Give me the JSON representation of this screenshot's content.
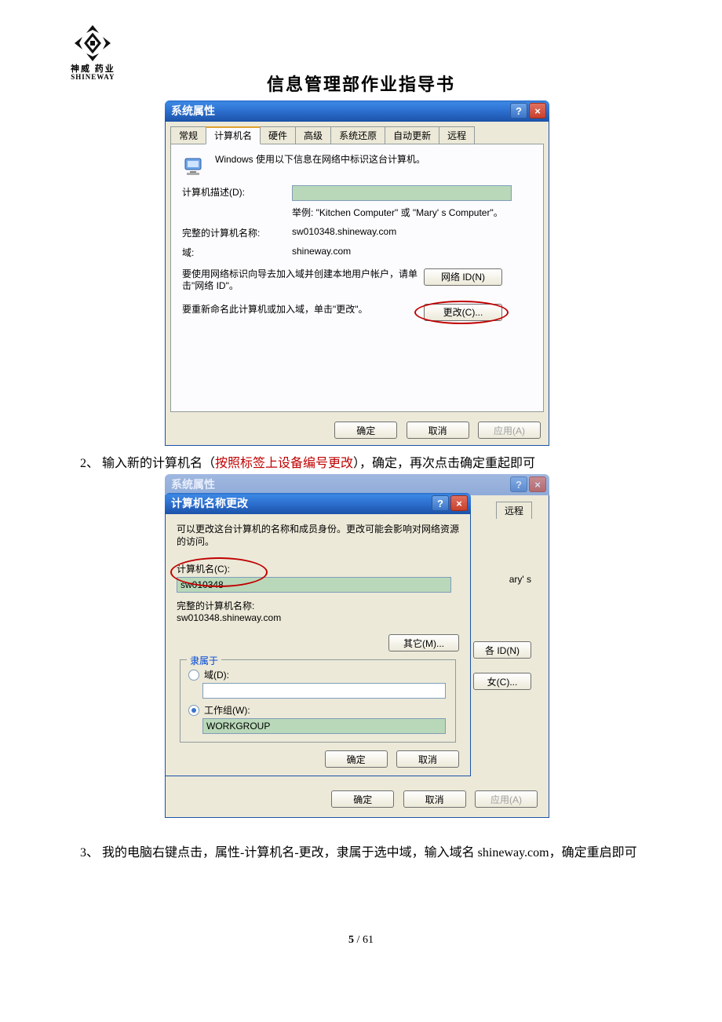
{
  "logo": {
    "line1": "神威 药业",
    "line2": "SHINEWAY"
  },
  "doc_title": "信息管理部作业指导书",
  "dlg1": {
    "title": "系统属性",
    "tabs": [
      "常规",
      "计算机名",
      "硬件",
      "高级",
      "系统还原",
      "自动更新",
      "远程"
    ],
    "banner": "Windows 使用以下信息在网络中标识这台计算机。",
    "desc_label": "计算机描述(D):",
    "example": "举例: \"Kitchen Computer\" 或 \"Mary' s Computer\"。",
    "fullname_label": "完整的计算机名称:",
    "fullname_value": "sw010348.shineway.com",
    "domain_label": "域:",
    "domain_value": "shineway.com",
    "netid_text": "要使用网络标识向导去加入域并创建本地用户帐户，请单击\"网络 ID\"。",
    "netid_btn": "网络 ID(N)",
    "change_text": "要重新命名此计算机或加入域，单击\"更改\"。",
    "change_btn": "更改(C)...",
    "ok": "确定",
    "cancel": "取消",
    "apply": "应用(A)"
  },
  "step2": {
    "prefix": "2、 输入新的计算机名（",
    "red": "按照标签上设备编号更改",
    "suffix": "），确定，再次点击确定重起即可"
  },
  "dlg2_under": {
    "title": "系统属性",
    "visible_tab": "远程",
    "peek1": "ary' s",
    "peek2": "各 ID(N)",
    "peek3": "女(C)...",
    "ok": "确定",
    "cancel": "取消",
    "apply": "应用(A)"
  },
  "dlg2": {
    "title": "计算机名称更改",
    "intro": "可以更改这台计算机的名称和成员身份。更改可能会影响对网络资源的访问。",
    "name_label": "计算机名(C):",
    "name_value": "sw010348",
    "fullname_label": "完整的计算机名称:",
    "fullname_value": "sw010348.shineway.com",
    "more_btn": "其它(M)...",
    "member_legend": "隶属于",
    "radio_domain": "域(D):",
    "radio_workgroup": "工作组(W):",
    "workgroup_value": "WORKGROUP",
    "ok": "确定",
    "cancel": "取消"
  },
  "step3": "3、 我的电脑右键点击，属性-计算机名-更改，隶属于选中域，输入域名 shineway.com，确定重启即可",
  "page_num_a": "5",
  "page_num_b": "61"
}
